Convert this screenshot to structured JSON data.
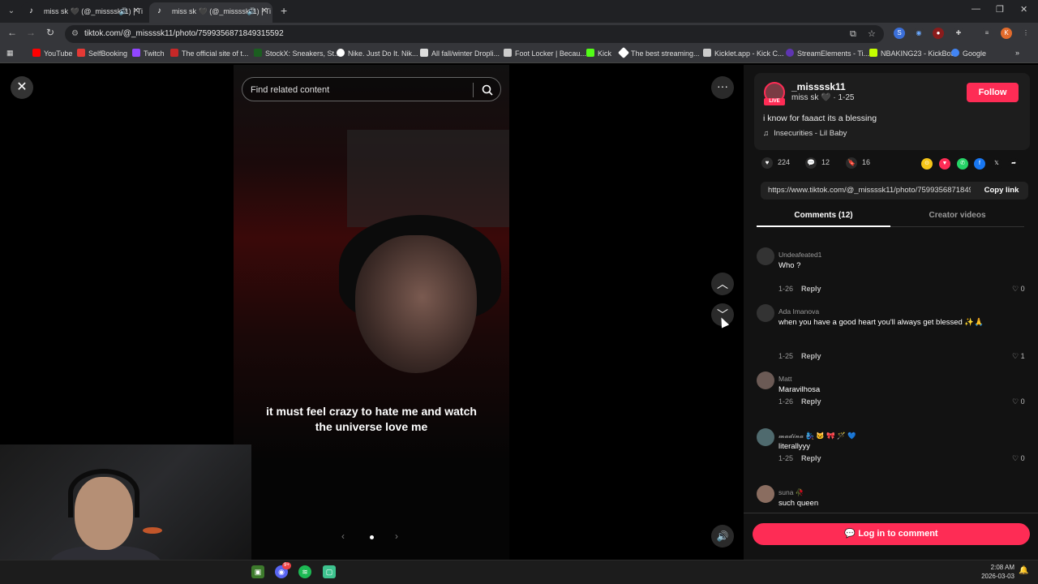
{
  "browser": {
    "tabs": [
      {
        "title": "miss sk 🖤 (@_missssk11) | Ti",
        "active": false
      },
      {
        "title": "miss sk 🖤 (@_missssk11) | Ti",
        "active": true
      }
    ],
    "url": "tiktok.com/@_missssk11/photo/7599356871849315592",
    "bookmarks": [
      {
        "label": "YouTube",
        "color": "#ff0000"
      },
      {
        "label": "SelfBooking",
        "color": "#e53935"
      },
      {
        "label": "Twitch",
        "color": "#9146ff"
      },
      {
        "label": "The official site of t...",
        "color": "#c62828"
      },
      {
        "label": "StockX: Sneakers, St...",
        "color": "#1b5e20"
      },
      {
        "label": "Nike. Just Do It. Nik...",
        "color": "#ffffff"
      },
      {
        "label": "All fall/winter Dropli...",
        "color": "#dddddd"
      },
      {
        "label": "Foot Locker | Becau...",
        "color": "#cccccc"
      },
      {
        "label": "Kick",
        "color": "#53fc18"
      },
      {
        "label": "The best streaming...",
        "color": "#ffffff"
      },
      {
        "label": "Kicklet.app - Kick C...",
        "color": "#cccccc"
      },
      {
        "label": "StreamElements - Ti...",
        "color": "#5e35b1"
      },
      {
        "label": "NBAKING23 - KickBot",
        "color": "#c6ff00"
      },
      {
        "label": "Google",
        "color": "#4285f4"
      }
    ],
    "profile_initial": "K"
  },
  "viewer": {
    "search_placeholder": "Find related content",
    "caption": "it must feel crazy to hate me and watch the universe love me"
  },
  "author": {
    "username": "_missssk11",
    "display": "miss sk 🖤 · 1-25",
    "live_label": "LIVE",
    "follow_label": "Follow",
    "description": "i know for faaact its a blessing",
    "music": "Insecurities - Lil Baby"
  },
  "stats": {
    "likes": "224",
    "comments": "12",
    "saves": "16"
  },
  "share_link": {
    "url": "https://www.tiktok.com/@_missssk11/photo/7599356871849315592",
    "copy_label": "Copy link"
  },
  "panel_tabs": {
    "comments": "Comments (12)",
    "creator": "Creator videos"
  },
  "comments": [
    {
      "user": "Undeafeated1",
      "text": "Who ?",
      "date": "1-26",
      "reply": "Reply",
      "likes": "0"
    },
    {
      "user": "Ada Imanova",
      "text": "when you have a good heart you'll always get blessed ✨🙏",
      "date": "1-25",
      "reply": "Reply",
      "likes": "1"
    },
    {
      "user": "Matt",
      "text": "Maravilhosa",
      "date": "1-26",
      "reply": "Reply",
      "likes": "0"
    },
    {
      "user": "𝓶𝓪𝓭𝓲𝓷𝓪 🧞‍♀️ 🐱 🎀 🪄 💙",
      "text": "literallyyy",
      "date": "1-25",
      "reply": "Reply",
      "likes": "0"
    },
    {
      "user": "suna 🥀",
      "text": "such queen",
      "date": "",
      "reply": "",
      "likes": ""
    }
  ],
  "login_label": "Log in to comment",
  "taskbar": {
    "time": "2:08 AM",
    "date": "2026-03-03",
    "discord_badge": "9+"
  },
  "colors": {
    "accent": "#fe2c55",
    "panel_bg": "#121212",
    "chrome_dark": "#202124",
    "chrome_mid": "#35363a"
  }
}
